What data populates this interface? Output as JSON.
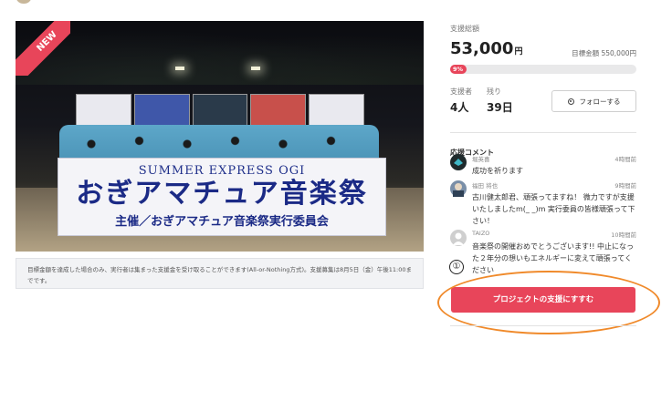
{
  "project": {
    "badge": "NEW",
    "banner_top": "SUMMER EXPRESS OGI",
    "banner_main": "おぎアマチュア音楽祭",
    "banner_sub": "主催／おぎアマチュア音楽祭実行委員会",
    "notice": "目標金額を達成した場合のみ、実行者は集まった支援金を受け取ることができます(All-or-Nothing方式)。支援募集は8月5日（金）午後11:00までです。"
  },
  "funding": {
    "total_label": "支援総額",
    "amount": "53,000",
    "currency": "円",
    "goal_text": "目標金額 550,000円",
    "progress_fraction": 0.09,
    "progress_label": "9%",
    "accent_color": "#e8455a"
  },
  "stats": {
    "supporters_label": "支援者",
    "supporters_value": "4人",
    "remaining_label": "残り",
    "remaining_value": "39日",
    "follow_label": "フォローする"
  },
  "comments": {
    "title": "応援コメント",
    "items": [
      {
        "name": "堀英喜",
        "time": "4時間前",
        "body": "成功を祈ります"
      },
      {
        "name": "福田 将也",
        "time": "9時間前",
        "body": "古川健太郎君、頑張ってますね！ 微力ですが支援いたしましたm(_ _)m 実行委員の皆様頑張って下さい！"
      },
      {
        "name": "TAIZO",
        "time": "10時間前",
        "body": "音楽祭の開催おめでとうございます!! 中止になった２年分の想いもエネルギーに変えて頑張ってください"
      }
    ]
  },
  "marker": "①",
  "cta_label": "プロジェクトの支援にすすむ"
}
